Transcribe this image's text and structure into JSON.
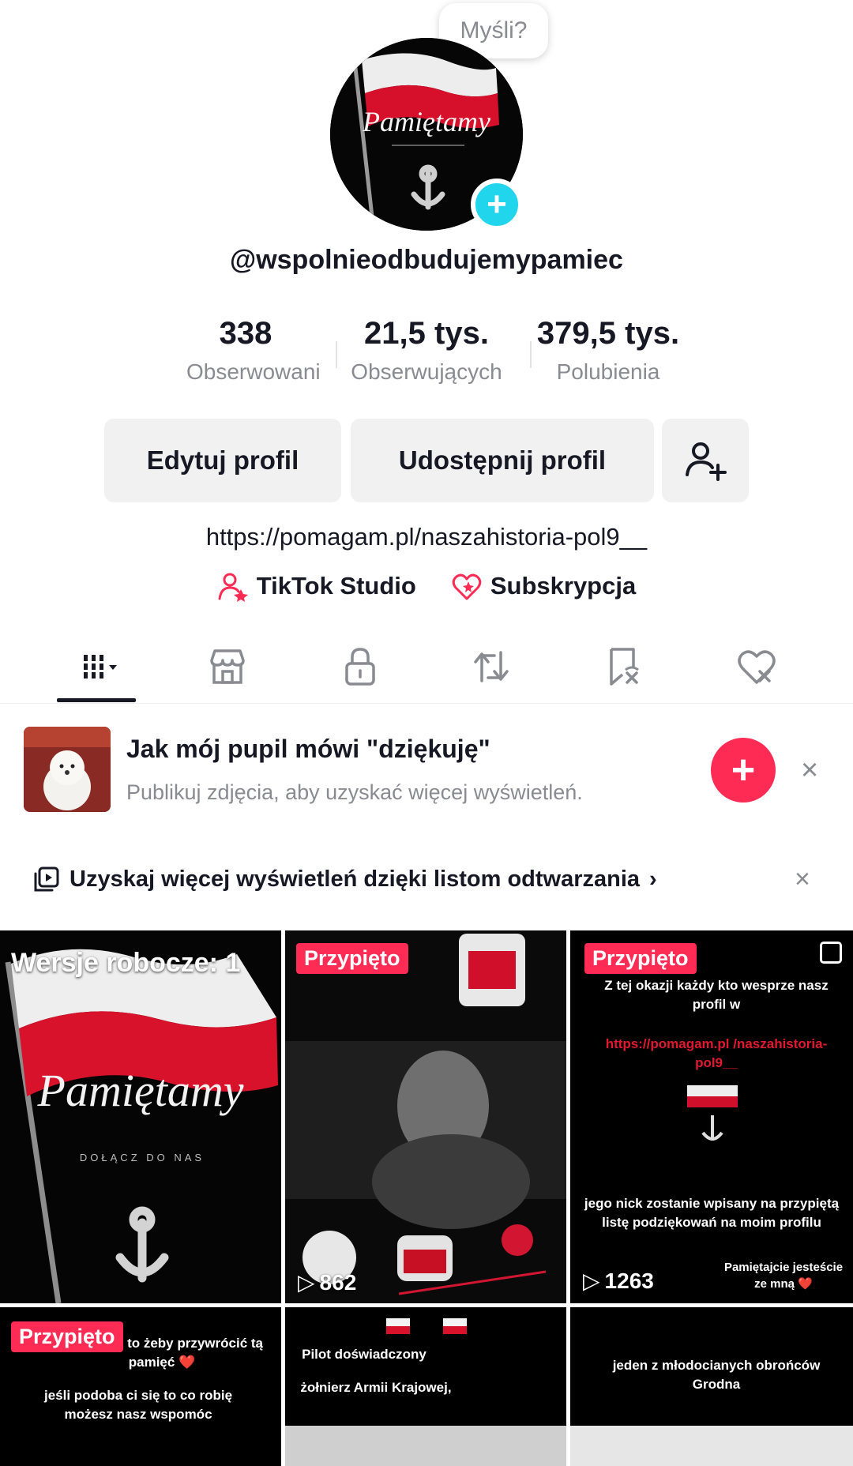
{
  "profile": {
    "thought_prompt": "Myśli?",
    "username": "@wspolnieodbudujemypamiec",
    "avatar_text": "Pamiętamy",
    "stats": [
      {
        "value": "338",
        "label": "Obserwowani"
      },
      {
        "value": "21,5 tys.",
        "label": "Obserwujących"
      },
      {
        "value": "379,5 tys.",
        "label": "Polubienia"
      }
    ],
    "edit_button": "Edytuj profil",
    "share_button": "Udostępnij profil",
    "bio_link": "https://pomagam.pl/naszahistoria-pol9__",
    "studio_label": "TikTok Studio",
    "subscription_label": "Subskrypcja"
  },
  "tabs": [
    {
      "name": "tab-videos",
      "icon": "grid-icon",
      "active": true
    },
    {
      "name": "tab-shop",
      "icon": "shop-icon"
    },
    {
      "name": "tab-private",
      "icon": "lock-icon"
    },
    {
      "name": "tab-reposts",
      "icon": "repost-icon"
    },
    {
      "name": "tab-favorites",
      "icon": "bookmark-icon"
    },
    {
      "name": "tab-liked",
      "icon": "heart-icon"
    }
  ],
  "promo": {
    "title": "Jak mój pupil mówi \"dziękuję\"",
    "subtitle": "Publikuj zdjęcia, aby uzyskać więcej wyświetleń."
  },
  "playlist_prompt": "Uzyskaj więcej wyświetleń dzięki listom odtwarzania",
  "grid": {
    "drafts_label": "Wersje robocze: 1",
    "draft_logo_text": "Pamiętamy",
    "draft_logo_sub": "DOŁĄCZ DO NAS",
    "pinned_label": "Przypięto",
    "video2_views": "862",
    "video3_views": "1263",
    "video3_text_top": "Z tej okazji każdy kto wesprze nasz profil w",
    "video3_link": "https://pomagam.pl /naszahistoria-pol9__",
    "video3_text_bottom": "jego nick zostanie wpisany na przypiętą listę podziękowań na moim profilu",
    "video3_caption": "Pamiętajcie jesteście ze mną ❤️",
    "video4_text": "jestem po to żeby przywrócić tą pamięć ❤️",
    "video4_text2": "jeśli podoba ci się to co robię możesz nasz wspomóc",
    "video5_text": "Pilot doświadczony",
    "video5_text2": "żołnierz Armii Krajowej,",
    "video6_text": "jeden z młodocianych obrońców Grodna"
  }
}
